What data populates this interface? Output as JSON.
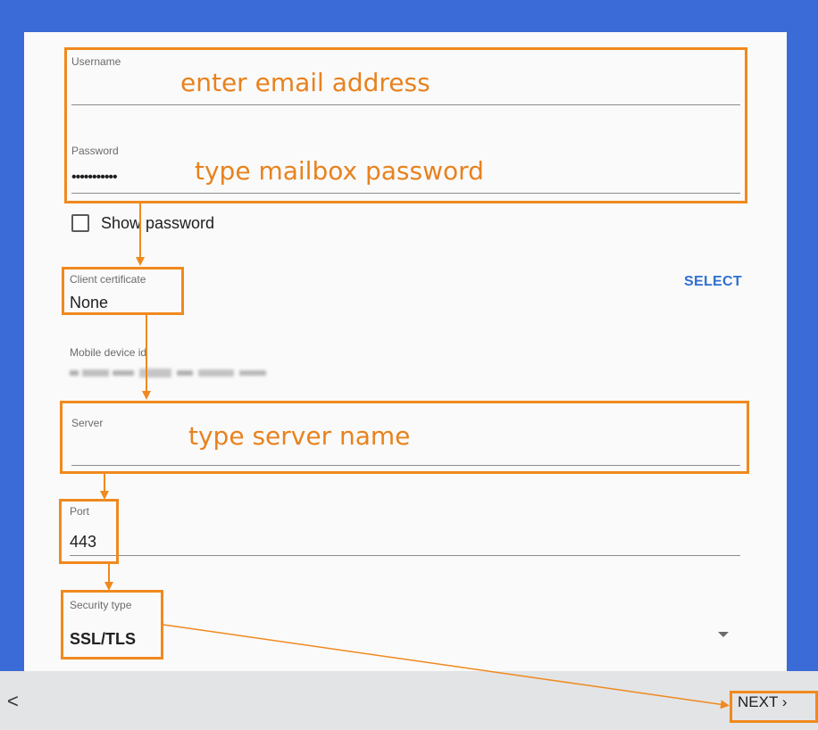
{
  "fields": {
    "username": {
      "label": "Username",
      "annotation": "enter email address"
    },
    "password": {
      "label": "Password",
      "value": "•••••••••••",
      "annotation": "type mailbox password"
    },
    "show_password": {
      "label": "Show password",
      "checked": false
    },
    "client_certificate": {
      "label": "Client certificate",
      "value": "None",
      "action": "SELECT"
    },
    "mobile_device_id": {
      "label": "Mobile device id"
    },
    "server": {
      "label": "Server",
      "annotation": "type server name"
    },
    "port": {
      "label": "Port",
      "value": "443"
    },
    "security_type": {
      "label": "Security type",
      "value": "SSL/TLS"
    }
  },
  "footer": {
    "back_icon": "<",
    "next_label": "NEXT ›"
  },
  "colors": {
    "blue_bg": "#3a6bd6",
    "annotation_orange": "#f0891e",
    "link_blue": "#2f6fd0"
  }
}
